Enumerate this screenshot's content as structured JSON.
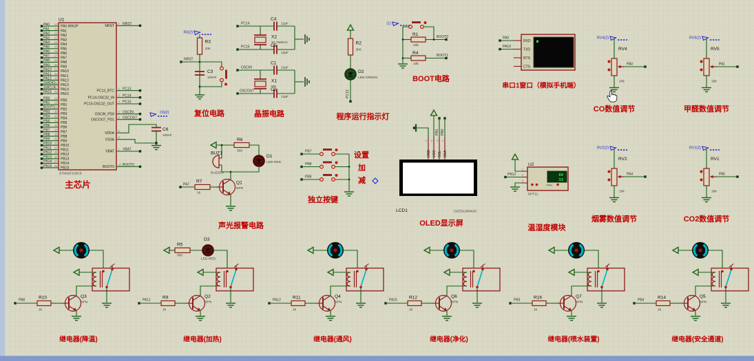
{
  "workspace": {
    "wire_color": "#176117",
    "component_color": "#8f1a1a",
    "caption_color": "#c10000",
    "probe_color": "#2626cc",
    "switch_color": "#00b4c5"
  },
  "chip": {
    "ref": "U1",
    "model": "STM32F103C8",
    "caption": "主芯片",
    "left_pins": [
      {
        "net": "PA0",
        "num": "10",
        "name": "PA0-WKUP"
      },
      {
        "net": "PA1",
        "num": "11",
        "name": "PA1"
      },
      {
        "net": "PA2",
        "num": "12",
        "name": "PA2"
      },
      {
        "net": "PA3",
        "num": "13",
        "name": "PA3"
      },
      {
        "net": "PA4",
        "num": "14",
        "name": "PA4"
      },
      {
        "net": "PA5",
        "num": "15",
        "name": "PA5"
      },
      {
        "net": "PA6",
        "num": "16",
        "name": "PA6"
      },
      {
        "net": "PA7",
        "num": "17",
        "name": "PA7"
      },
      {
        "net": "PA8",
        "num": "29",
        "name": "PA8"
      },
      {
        "net": "PA9",
        "num": "30",
        "name": "PA9"
      },
      {
        "net": "PA10",
        "num": "31",
        "name": "PA10"
      },
      {
        "net": "PA11",
        "num": "32",
        "name": "PA11"
      },
      {
        "net": "PA12",
        "num": "33",
        "name": "PA12"
      },
      {
        "net": "SWDIO",
        "num": "34",
        "name": "PA13"
      },
      {
        "net": "SWCLK",
        "num": "37",
        "name": "PA14"
      },
      {
        "net": "PA15",
        "num": "38",
        "name": "PA15"
      },
      {
        "net": "PB0",
        "num": "18",
        "name": "PB0"
      },
      {
        "net": "PB1",
        "num": "19",
        "name": "PB1"
      },
      {
        "net": "BOOT1",
        "num": "20",
        "name": "PB2"
      },
      {
        "net": "PB3",
        "num": "39",
        "name": "PB3"
      },
      {
        "net": "PB4",
        "num": "40",
        "name": "PB4"
      },
      {
        "net": "PB5",
        "num": "41",
        "name": "PB5"
      },
      {
        "net": "PB6",
        "num": "42",
        "name": "PB6"
      },
      {
        "net": "PB7",
        "num": "43",
        "name": "PB7"
      },
      {
        "net": "PB8",
        "num": "45",
        "name": "PB8"
      },
      {
        "net": "PB9",
        "num": "46",
        "name": "PB9"
      },
      {
        "net": "PB10",
        "num": "21",
        "name": "PB10"
      },
      {
        "net": "PB11",
        "num": "22",
        "name": "PB11"
      },
      {
        "net": "PB12",
        "num": "25",
        "name": "PB12"
      },
      {
        "net": "PB13",
        "num": "26",
        "name": "PB13"
      },
      {
        "net": "PB14",
        "num": "27",
        "name": "PB14"
      },
      {
        "net": "PB15",
        "num": "28",
        "name": "PB15"
      }
    ],
    "right_pins": [
      {
        "net": "NRST",
        "num": "7",
        "name": "NRST"
      },
      {
        "net": "PC13",
        "num": "2",
        "name": "PC13_RTC"
      },
      {
        "net": "PC14",
        "num": "3",
        "name": "PC14-OSC32_IN"
      },
      {
        "net": "PC15",
        "num": "4",
        "name": "PC15-OSC32_OUT"
      },
      {
        "net": "OSCIN",
        "num": "5",
        "name": "OSCIN_PD0"
      },
      {
        "net": "OSCOUT",
        "num": "6",
        "name": "OSCOUT_PD1"
      },
      {
        "net": "",
        "num": "9",
        "name": "VDDA"
      },
      {
        "net": "",
        "num": "8",
        "name": "VSSA"
      },
      {
        "net": "VBAT",
        "num": "1",
        "name": "VBAT"
      },
      {
        "net": "BOOT0",
        "num": "44",
        "name": "BOOT0"
      }
    ],
    "cap": {
      "ref": "C6",
      "value": "100nF",
      "probe": "C6(2)"
    }
  },
  "reset": {
    "caption": "复位电路",
    "probe": "R3(2)",
    "net": "NRST",
    "r_ref": "R3",
    "r_val": "10k",
    "c_ref": "C3",
    "c_val": "100nF"
  },
  "crystal": {
    "caption": "晶振电路",
    "x2_ref": "X2",
    "x2_val": "32.768KHz",
    "x1_ref": "X1",
    "x1_val": "8M",
    "c4_ref": "C4",
    "c4_val": "12pF",
    "c5_ref": "C5",
    "c5_val": "12pF",
    "c1_ref": "C1",
    "c1_val": "12pF",
    "c2_ref": "C2",
    "c2_val": "12pF",
    "net_pc14": "PC14",
    "net_pc15": "PC15",
    "net_oscin": "OSCIN",
    "net_oscout": "OSCOUT"
  },
  "run_led": {
    "caption": "程序运行指示灯",
    "r_ref": "R2",
    "r_val": "300",
    "d_ref": "D2",
    "d_val": "LED-GREEN",
    "net": "PC13"
  },
  "boot": {
    "caption": "BOOT电路",
    "probe": "(1)",
    "r1_ref": "R1",
    "r1_val": "10k",
    "net1": "BOOT0",
    "r4_ref": "R4",
    "r4_val": "10k",
    "net2": "BOOT1"
  },
  "serial": {
    "caption": "串口1窗口（模拟手机端）",
    "pin_rxd": "RXD",
    "pin_txd": "TXD",
    "pin_rts": "RTS",
    "pin_cts": "CTS",
    "net_rxd": "PA9",
    "net_txd": "PA10"
  },
  "pots": [
    {
      "probe": "RV4(2)",
      "ref": "RV4",
      "value": "10k",
      "net": "PA0",
      "caption": "CO数值调节"
    },
    {
      "probe": "RV5(2)",
      "ref": "RV5",
      "value": "10k",
      "net": "PA1",
      "caption": "甲醛数值调节"
    },
    {
      "probe": "RV2(2)",
      "ref": "RV2",
      "value": "10k",
      "net": "PA4",
      "caption": "烟雾数值调节"
    },
    {
      "probe": "RV1(2)",
      "ref": "RV1",
      "value": "10k",
      "net": "PA5",
      "caption": "CO2数值调节"
    }
  ],
  "alarm": {
    "caption": "声光报警电路",
    "r6_ref": "R6",
    "r6_val": "300",
    "buz_ref": "BUZ1",
    "buz_val": "BUZZER",
    "d1_ref": "D1",
    "d1_val": "LED-RED",
    "q1_ref": "Q1",
    "q1_val": "NPN",
    "r7_ref": "R7",
    "r7_val": "1k",
    "net": "PA7"
  },
  "keys": {
    "caption": "独立按键",
    "rows": [
      {
        "net": "PB7",
        "label": "设置"
      },
      {
        "net": "PB8",
        "label": "加"
      },
      {
        "net": "PB9",
        "label": "减"
      }
    ]
  },
  "oled": {
    "caption": "OLED显示屏",
    "ref": "LCD1",
    "model": "OLED12864I2C",
    "pins": [
      "GND",
      "VCC",
      "SCL",
      "SDA"
    ],
    "nums": [
      "1",
      "2",
      "3",
      "4"
    ],
    "net_scl": "PB1",
    "net_sda": "PB0"
  },
  "dht": {
    "caption": "温湿度模块",
    "ref": "U2",
    "model": "DHT11",
    "pins": [
      "VDD",
      "DATA",
      "GND"
    ],
    "nums": [
      "1",
      "2",
      "3"
    ],
    "net": "PB12",
    "value_top": "80",
    "value_bottom": "33",
    "unit": "%RH"
  },
  "relays": [
    {
      "caption": "继电器(降温)",
      "net": "PA8",
      "r_ref": "R10",
      "r_val": "1k",
      "q_ref": "Q3",
      "q_val": "NPN",
      "load": "motor"
    },
    {
      "caption": "继电器(加热)",
      "net": "PA11",
      "r_ref": "R9",
      "r_val": "1k",
      "q_ref": "Q2",
      "q_val": "NPN",
      "load": "led",
      "r5_ref": "R5",
      "r5_val": "300",
      "d3_ref": "D3",
      "d3_val": "LED-RED"
    },
    {
      "caption": "继电器(通风)",
      "net": "PA12",
      "r_ref": "R11",
      "r_val": "1k",
      "q_ref": "Q4",
      "q_val": "NPN",
      "load": "motor"
    },
    {
      "caption": "继电器(净化)",
      "net": "PA15",
      "r_ref": "R12",
      "r_val": "1k",
      "q_ref": "Q6",
      "q_val": "NPN",
      "load": "motor"
    },
    {
      "caption": "继电器(喷水装置)",
      "net": "PB3",
      "r_ref": "R16",
      "r_val": "1k",
      "q_ref": "Q7",
      "q_val": "NPN",
      "load": "motor"
    },
    {
      "caption": "继电器(安全通道)",
      "net": "PB4",
      "r_ref": "R14",
      "r_val": "1k",
      "q_ref": "Q5",
      "q_val": "NPN",
      "load": "motor"
    }
  ]
}
